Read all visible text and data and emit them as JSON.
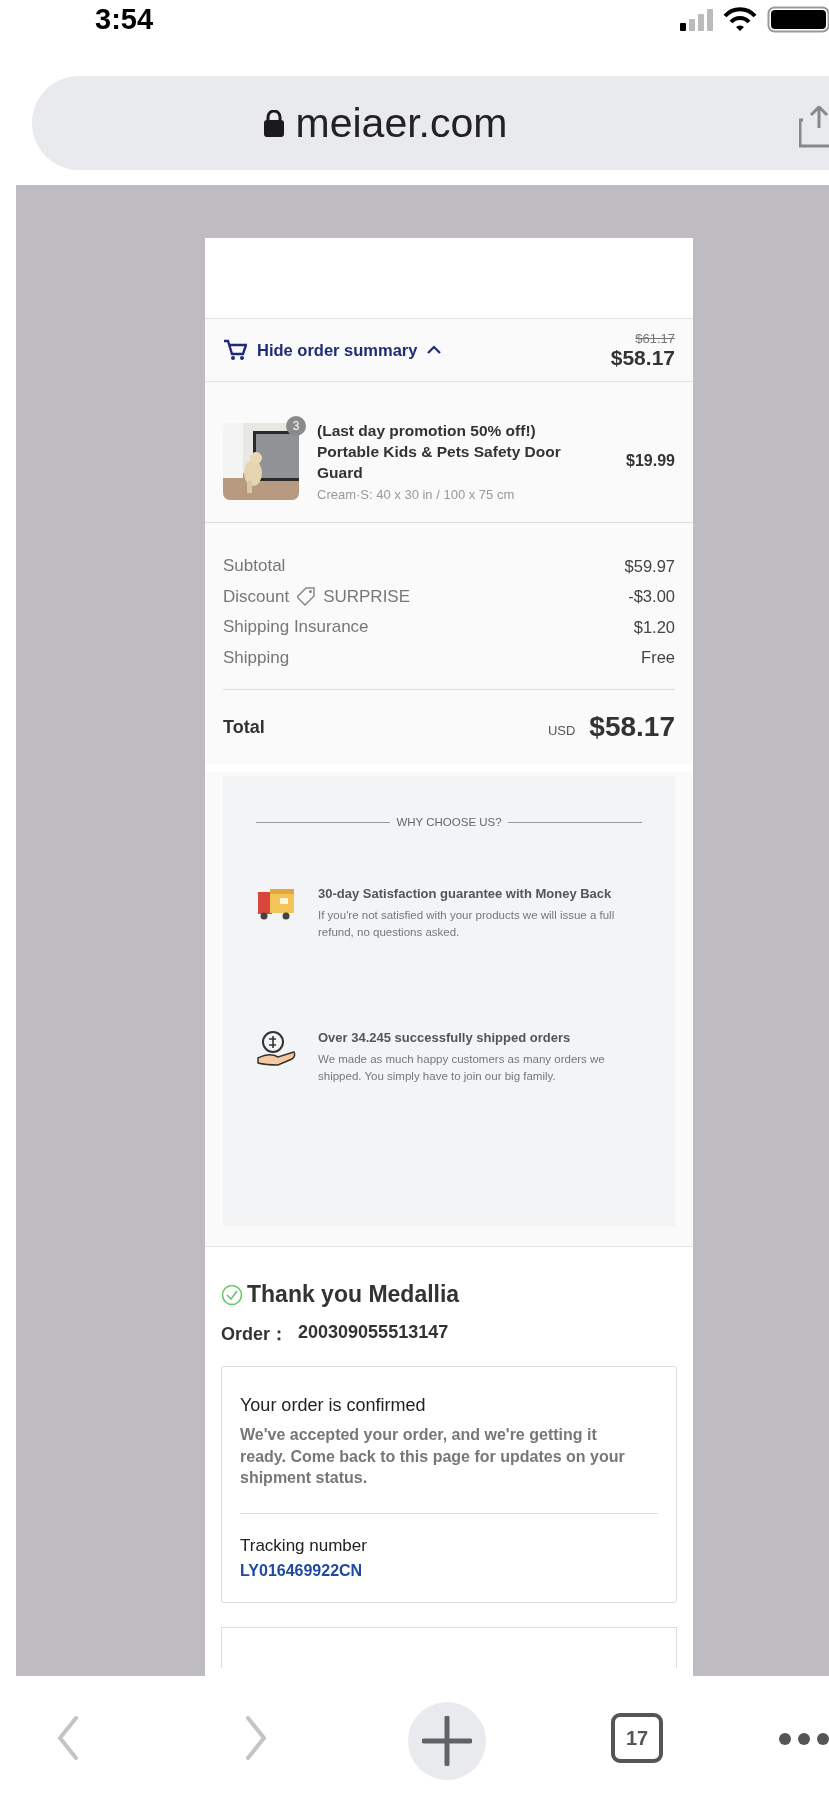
{
  "status_bar": {
    "time": "3:54"
  },
  "address_bar": {
    "secure": true,
    "url": "meiaer.com"
  },
  "order_summary": {
    "toggle_label": "Hide order summary",
    "expanded": true,
    "original_total": "$61.17",
    "total": "$58.17"
  },
  "items": [
    {
      "kind": "picture",
      "quantity": "3",
      "title": "(Last day promotion 50% off!) Portable Kids & Pets Safety Door Guard",
      "variant": "Cream·S: 40 x 30 in / 100 x 75 cm",
      "price": "$19.99"
    }
  ],
  "totals": [
    {
      "label": "Subtotal",
      "value": "$59.97"
    },
    {
      "label": "Discount",
      "code": "SURPRISE",
      "value": "-$3.00"
    },
    {
      "label": "Shipping Insurance",
      "value": "$1.20"
    },
    {
      "label": "Shipping",
      "value": "Free"
    }
  ],
  "grand_total": {
    "label": "Total",
    "currency": "USD",
    "amount": "$58.17"
  },
  "why_choose": {
    "title": "WHY CHOOSE US?",
    "features": [
      {
        "kind": "delivery",
        "heading": "30-day Satisfaction guarantee with Money Back",
        "text": "If you're not satisfied with your products we will issue a full refund, no questions asked."
      },
      {
        "kind": "money",
        "heading": "Over 34.245 successfully shipped orders",
        "text": "We made as much happy customers as many orders we shipped. You simply have to join our big family."
      }
    ]
  },
  "thank_you": {
    "heading": "Thank you Medallia",
    "order_label": "Order：",
    "order_number": "200309055513147"
  },
  "confirmation": {
    "title": "Your order is confirmed",
    "text": "We've accepted your order, and we're getting it ready. Come back to this page for updates on your shipment status.",
    "tracking_label": "Tracking number",
    "tracking_number": "LY016469922CN"
  },
  "toolbar": {
    "tabs_count": "17"
  }
}
